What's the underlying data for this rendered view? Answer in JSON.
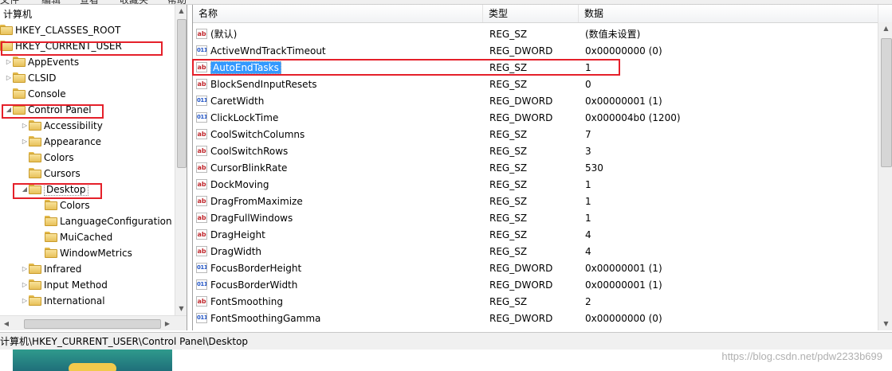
{
  "tree": {
    "root": "计算机",
    "items": [
      {
        "label": "HKEY_CLASSES_ROOT",
        "level": 0,
        "expander": "none"
      },
      {
        "label": "HKEY_CURRENT_USER",
        "level": 0,
        "expander": "none"
      },
      {
        "label": "AppEvents",
        "level": 1,
        "expander": "collapsed"
      },
      {
        "label": "CLSID",
        "level": 1,
        "expander": "collapsed"
      },
      {
        "label": "Console",
        "level": 1,
        "expander": "none"
      },
      {
        "label": "Control Panel",
        "level": 1,
        "expander": "expanded"
      },
      {
        "label": "Accessibility",
        "level": 2,
        "expander": "collapsed"
      },
      {
        "label": "Appearance",
        "level": 2,
        "expander": "collapsed"
      },
      {
        "label": "Colors",
        "level": 2,
        "expander": "none"
      },
      {
        "label": "Cursors",
        "level": 2,
        "expander": "none"
      },
      {
        "label": "Desktop",
        "level": 2,
        "expander": "expanded",
        "selected": true
      },
      {
        "label": "Colors",
        "level": 3,
        "expander": "none"
      },
      {
        "label": "LanguageConfiguration",
        "level": 3,
        "expander": "none"
      },
      {
        "label": "MuiCached",
        "level": 3,
        "expander": "none"
      },
      {
        "label": "WindowMetrics",
        "level": 3,
        "expander": "none"
      },
      {
        "label": "Infrared",
        "level": 2,
        "expander": "collapsed"
      },
      {
        "label": "Input Method",
        "level": 2,
        "expander": "collapsed"
      },
      {
        "label": "International",
        "level": 2,
        "expander": "collapsed"
      }
    ]
  },
  "list": {
    "headers": {
      "name": "名称",
      "type": "类型",
      "data": "数据"
    },
    "rows": [
      {
        "name": "(默认)",
        "type": "REG_SZ",
        "data": "(数值未设置)",
        "kind": "sz"
      },
      {
        "name": "ActiveWndTrackTimeout",
        "type": "REG_DWORD",
        "data": "0x00000000 (0)",
        "kind": "dword"
      },
      {
        "name": "AutoEndTasks",
        "type": "REG_SZ",
        "data": "1",
        "kind": "sz",
        "selected": true
      },
      {
        "name": "BlockSendInputResets",
        "type": "REG_SZ",
        "data": "0",
        "kind": "sz"
      },
      {
        "name": "CaretWidth",
        "type": "REG_DWORD",
        "data": "0x00000001 (1)",
        "kind": "dword"
      },
      {
        "name": "ClickLockTime",
        "type": "REG_DWORD",
        "data": "0x000004b0 (1200)",
        "kind": "dword"
      },
      {
        "name": "CoolSwitchColumns",
        "type": "REG_SZ",
        "data": "7",
        "kind": "sz"
      },
      {
        "name": "CoolSwitchRows",
        "type": "REG_SZ",
        "data": "3",
        "kind": "sz"
      },
      {
        "name": "CursorBlinkRate",
        "type": "REG_SZ",
        "data": "530",
        "kind": "sz"
      },
      {
        "name": "DockMoving",
        "type": "REG_SZ",
        "data": "1",
        "kind": "sz"
      },
      {
        "name": "DragFromMaximize",
        "type": "REG_SZ",
        "data": "1",
        "kind": "sz"
      },
      {
        "name": "DragFullWindows",
        "type": "REG_SZ",
        "data": "1",
        "kind": "sz"
      },
      {
        "name": "DragHeight",
        "type": "REG_SZ",
        "data": "4",
        "kind": "sz"
      },
      {
        "name": "DragWidth",
        "type": "REG_SZ",
        "data": "4",
        "kind": "sz"
      },
      {
        "name": "FocusBorderHeight",
        "type": "REG_DWORD",
        "data": "0x00000001 (1)",
        "kind": "dword"
      },
      {
        "name": "FocusBorderWidth",
        "type": "REG_DWORD",
        "data": "0x00000001 (1)",
        "kind": "dword"
      },
      {
        "name": "FontSmoothing",
        "type": "REG_SZ",
        "data": "2",
        "kind": "sz"
      },
      {
        "name": "FontSmoothingGamma",
        "type": "REG_DWORD",
        "data": "0x00000000 (0)",
        "kind": "dword"
      }
    ]
  },
  "statusbar": {
    "path": "计算机\\HKEY_CURRENT_USER\\Control Panel\\Desktop"
  },
  "watermark": "https://blog.csdn.net/pdw2233b699",
  "colors": {
    "highlight_box": "#e5202a",
    "selection": "#3399ff"
  }
}
